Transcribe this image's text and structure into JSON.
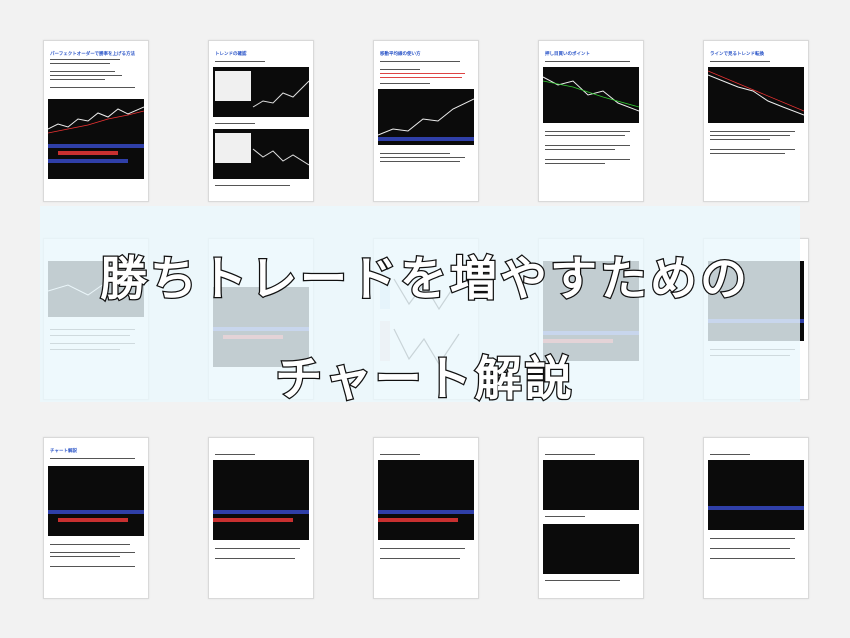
{
  "overlay": {
    "title_line1": "勝ちトレードを増やすための",
    "title_line2": "チャート解説"
  },
  "pages": [
    {
      "heading": "パーフェクトオーダーで勝率を上げる方法"
    },
    {
      "heading": "トレンドの確認"
    },
    {
      "heading": "移動平均線の使い方"
    },
    {
      "heading": "押し目買いのポイント"
    },
    {
      "heading": "ラインで見るトレンド転換"
    },
    {
      "heading": "チャート解説"
    }
  ]
}
